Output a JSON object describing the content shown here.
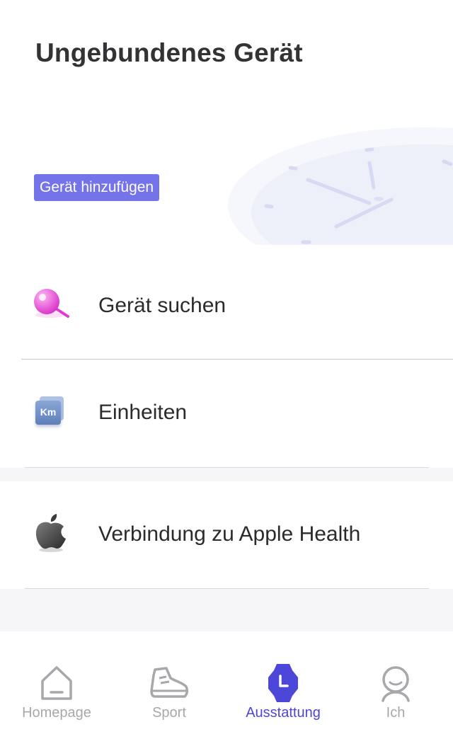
{
  "page": {
    "title": "Ungebundenes Gerät"
  },
  "hero": {
    "add_button": "Gerät hinzufügen"
  },
  "menu": [
    {
      "label": "Gerät suchen",
      "icon": "magnifier-icon"
    },
    {
      "label": "Einheiten",
      "icon": "km-units-icon",
      "icon_text": "Km"
    },
    {
      "label": "Verbindung zu Apple Health",
      "icon": "apple-icon"
    }
  ],
  "tabs": [
    {
      "label": "Homepage",
      "icon": "home-icon",
      "active": false
    },
    {
      "label": "Sport",
      "icon": "shoe-icon",
      "active": false
    },
    {
      "label": "Ausstattung",
      "icon": "watch-icon",
      "active": true
    },
    {
      "label": "Ich",
      "icon": "person-icon",
      "active": false
    }
  ],
  "colors": {
    "accent": "#7473ea",
    "tab_active": "#4d47d9",
    "tab_inactive": "#a7a7ac",
    "magnifier": "#e23ad0"
  }
}
